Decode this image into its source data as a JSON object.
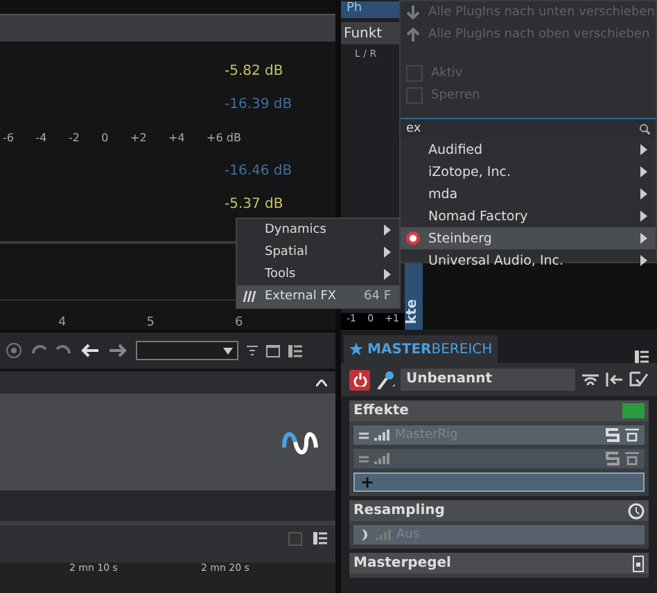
{
  "meter": {
    "readings": [
      {
        "text": "-5.82 dB",
        "kind": "peak"
      },
      {
        "text": "-16.39 dB",
        "kind": "rms"
      },
      {
        "kind": "scale"
      },
      {
        "text": "-16.46 dB",
        "kind": "rms"
      },
      {
        "text": "-5.37 dB",
        "kind": "peak"
      }
    ],
    "scale": [
      "-6",
      "-4",
      "-2",
      "0",
      "+2",
      "+4",
      "+6 dB"
    ]
  },
  "timeline": {
    "ticks": [
      "4",
      "5",
      "6"
    ]
  },
  "plugin_panel": {
    "tab": "Ph",
    "button": "Funkt",
    "channel": "L / R",
    "side_tab": "kte",
    "scale": [
      "-1",
      "0",
      "+1"
    ]
  },
  "plugin_menu": {
    "items": [
      {
        "label": "Alle PlugIns nach unten verschieben",
        "kind": "down",
        "disabled": true
      },
      {
        "label": "Alle PlugIns nach oben verschieben",
        "kind": "up",
        "disabled": true
      },
      {
        "label": "Aktiv",
        "kind": "check",
        "disabled": true,
        "checked": false
      },
      {
        "label": "Sperren",
        "kind": "check",
        "disabled": true,
        "checked": false
      }
    ],
    "search": {
      "value": "ex"
    },
    "vendors": [
      {
        "label": "Audified",
        "selected": false
      },
      {
        "label": "iZotope, Inc.",
        "selected": false
      },
      {
        "label": "mda",
        "selected": false
      },
      {
        "label": "Nomad Factory",
        "selected": false
      },
      {
        "label": "Steinberg",
        "selected": true
      },
      {
        "label": "Universal Audio, Inc.",
        "selected": false
      }
    ]
  },
  "submenu": {
    "items": [
      {
        "label": "Dynamics",
        "selected": false
      },
      {
        "label": "Spatial",
        "selected": false
      },
      {
        "label": "Tools",
        "selected": false
      },
      {
        "label": "External FX",
        "selected": true,
        "shortcut": "64 F"
      }
    ]
  },
  "lower_ruler": [
    "2 mn 10 s",
    "2 mn 20 s"
  ],
  "master": {
    "tab": "**MASTER**BEREICH",
    "power_on": true,
    "preset": "Unbenannt",
    "sections": [
      {
        "title": "Effekte",
        "kind": "effects",
        "slots": [
          {
            "kind": "plugin",
            "label": "MasterRig"
          },
          {
            "kind": "empty"
          },
          {
            "kind": "add",
            "label": "+"
          }
        ]
      },
      {
        "title": "Resampling",
        "kind": "resampling",
        "slots": [
          {
            "kind": "off",
            "label": "Aus"
          }
        ]
      },
      {
        "title": "Masterpegel",
        "kind": "level"
      }
    ]
  }
}
